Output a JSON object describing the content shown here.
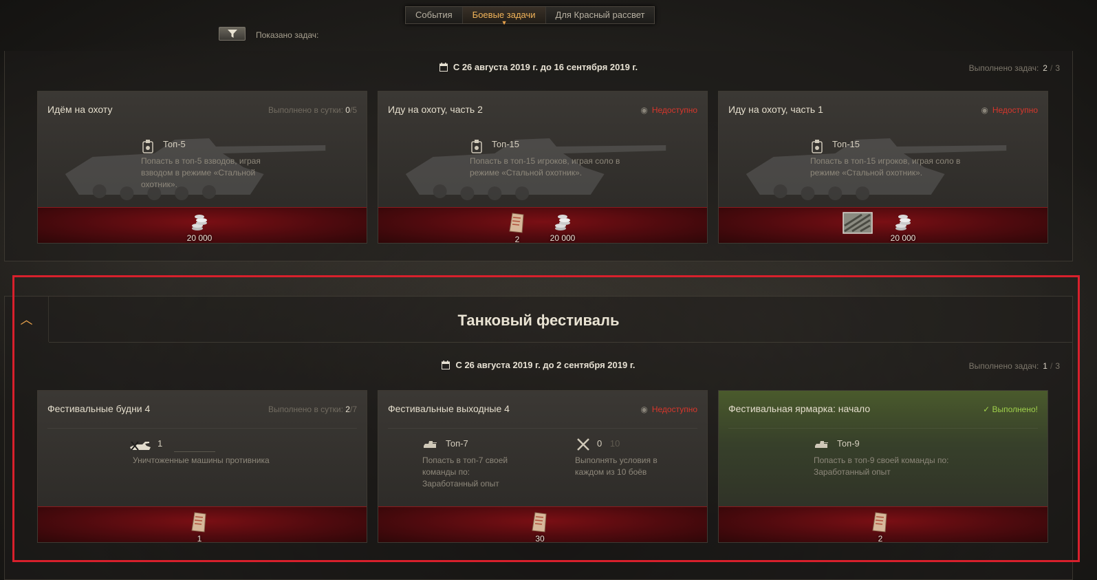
{
  "tabs": [
    {
      "label": "События",
      "active": false
    },
    {
      "label": "Боевые задачи",
      "active": true
    },
    {
      "label": "Для Красный рассвет",
      "active": false
    }
  ],
  "filter": {
    "label": "Показано задач:"
  },
  "campaign1": {
    "date": "С 26 августа 2019 г. до 16 сентября 2019 г.",
    "done_label": "Выполнено задач:",
    "done_value": "2",
    "done_total": "3",
    "cards": [
      {
        "title": "Идём на охоту",
        "status_label": "Выполнено в сутки:",
        "status_value": "0",
        "status_total": "5",
        "cond_name": "Топ-5",
        "cond_text": "Попасть в топ-5 взводов, играя взводом в режиме «Стальной охотник».",
        "rewards": [
          {
            "icon": "credits-icon",
            "value": "20 000"
          }
        ]
      },
      {
        "title": "Иду на охоту, часть 2",
        "status": "Недоступно",
        "cond_name": "Топ-15",
        "cond_text": "Попасть в топ-15 игроков, играя соло в режиме «Стальной охотник».",
        "rewards": [
          {
            "icon": "ticket-icon",
            "value": "2"
          },
          {
            "icon": "credits-icon",
            "value": "20 000"
          }
        ]
      },
      {
        "title": "Иду на охоту, часть 1",
        "status": "Недоступно",
        "cond_name": "Топ-15",
        "cond_text": "Попасть в топ-15 игроков, играя соло в режиме «Стальной охотник».",
        "rewards": [
          {
            "icon": "camo-icon",
            "value": ""
          },
          {
            "icon": "credits-icon",
            "value": "20 000"
          }
        ]
      }
    ]
  },
  "campaign2": {
    "title": "Танковый фестиваль",
    "date": "С 26 августа 2019 г. до 2 сентября 2019 г.",
    "done_label": "Выполнено задач:",
    "done_value": "1",
    "done_total": "3",
    "cards": [
      {
        "title": "Фестивальные будни 4",
        "status_label": "Выполнено в сутки:",
        "status_value": "2",
        "status_total": "7",
        "cond_count": "1",
        "cond_text": "Уничтоженные машины противника",
        "rewards": [
          {
            "icon": "ticket-icon",
            "value": "1"
          }
        ]
      },
      {
        "title": "Фестивальные выходные 4",
        "status": "Недоступно",
        "cond1_name": "Топ-7",
        "cond1_text": "Попасть в топ-7 своей команды по: Заработанный опыт",
        "cond2_value": "0",
        "cond2_total": "10",
        "cond2_text": "Выполнять условия в каждом из 10 боёв",
        "rewards": [
          {
            "icon": "ticket-icon",
            "value": "30"
          }
        ]
      },
      {
        "title": "Фестивальная ярмарка: начало",
        "status": "✓ Выполнено!",
        "cond_name": "Топ-9",
        "cond_text": "Попасть в топ-9 своей команды по: Заработанный опыт",
        "rewards": [
          {
            "icon": "ticket-icon",
            "value": "2"
          }
        ]
      }
    ]
  },
  "colors": {
    "accent": "#f2b45a",
    "unavailable": "#d8362c",
    "completed": "#9fd04b",
    "highlight": "#d8202c"
  }
}
